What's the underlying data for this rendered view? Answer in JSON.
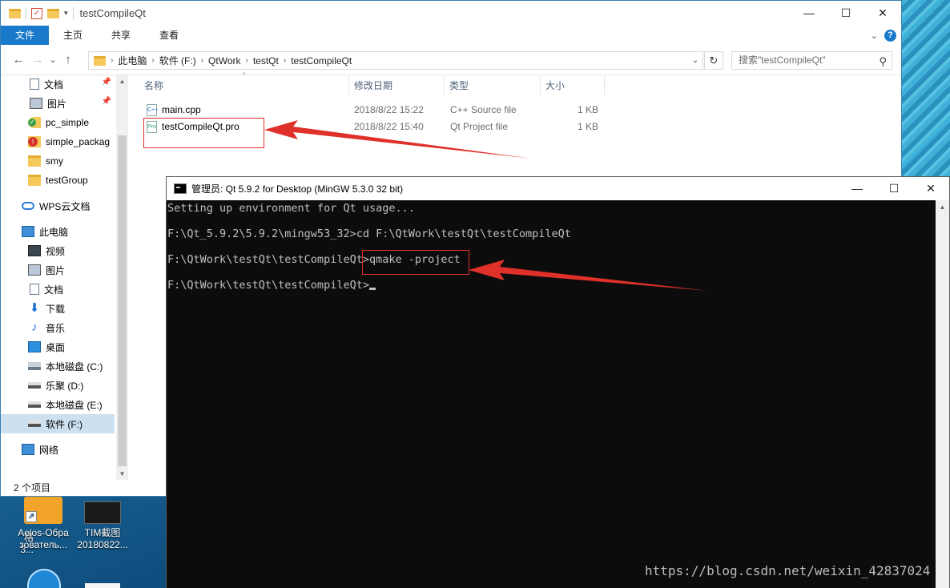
{
  "explorer": {
    "title": "testCompileQt",
    "window_buttons": {
      "minimize": "—",
      "maximize": "☐",
      "close": "✕"
    },
    "ribbon_tabs": [
      {
        "label": "文件",
        "active": true
      },
      {
        "label": "主页"
      },
      {
        "label": "共享"
      },
      {
        "label": "查看"
      }
    ],
    "nav_buttons": {
      "back": "←",
      "forward": "→",
      "recent": "⌄",
      "up": "↑"
    },
    "breadcrumbs": [
      "此电脑",
      "软件 (F:)",
      "QtWork",
      "testQt",
      "testCompileQt"
    ],
    "refresh": "↻",
    "search": {
      "placeholder": "搜索\"testCompileQt\""
    },
    "nav_pane": {
      "items": [
        {
          "label": "文档",
          "pinned": true
        },
        {
          "label": "图片",
          "pinned": true
        },
        {
          "label": "pc_simple"
        },
        {
          "label": "simple_packag"
        },
        {
          "label": "smy"
        },
        {
          "label": "testGroup"
        },
        {
          "label": "WPS云文档"
        },
        {
          "label": "此电脑"
        },
        {
          "label": "视频"
        },
        {
          "label": "图片"
        },
        {
          "label": "文档"
        },
        {
          "label": "下载"
        },
        {
          "label": "音乐"
        },
        {
          "label": "桌面"
        },
        {
          "label": "本地磁盘 (C:)"
        },
        {
          "label": "乐聚 (D:)"
        },
        {
          "label": "本地磁盘 (E:)"
        },
        {
          "label": "软件 (F:)",
          "selected": true
        },
        {
          "label": "网络"
        }
      ]
    },
    "columns": [
      "名称",
      "修改日期",
      "类型",
      "大小"
    ],
    "files": [
      {
        "name": "main.cpp",
        "date": "2018/8/22 15:22",
        "type": "C++ Source file",
        "size": "1 KB"
      },
      {
        "name": "testCompileQt.pro",
        "date": "2018/8/22 15:40",
        "type": "Qt Project file",
        "size": "1 KB"
      }
    ],
    "status": "2 个项目"
  },
  "console": {
    "title": "管理员: Qt 5.9.2 for Desktop (MinGW 5.3.0 32 bit)",
    "window_buttons": {
      "minimize": "—",
      "maximize": "☐",
      "close": "✕"
    },
    "lines": [
      "Setting up environment for Qt usage...",
      "F:\\Qt_5.9.2\\5.9.2\\mingw53_32>cd F:\\QtWork\\testQt\\testCompileQt",
      "F:\\QtWork\\testQt\\testCompileQt>qmake -project",
      "F:\\QtWork\\testQt\\testCompileQt>"
    ]
  },
  "desktop": {
    "icons": [
      {
        "label_line1": "Aelos-Обра",
        "label_line2": "зователь..."
      },
      {
        "label_line1": "TIM截图",
        "label_line2": "20180822..."
      }
    ],
    "partial_label_line1": "格",
    "partial_label_line2": "3..."
  },
  "watermark": "https://blog.csdn.net/weixin_42837024",
  "colors": {
    "accent": "#1979ca",
    "annotation": "#e0302a",
    "console_bg": "#0c0c0c"
  }
}
